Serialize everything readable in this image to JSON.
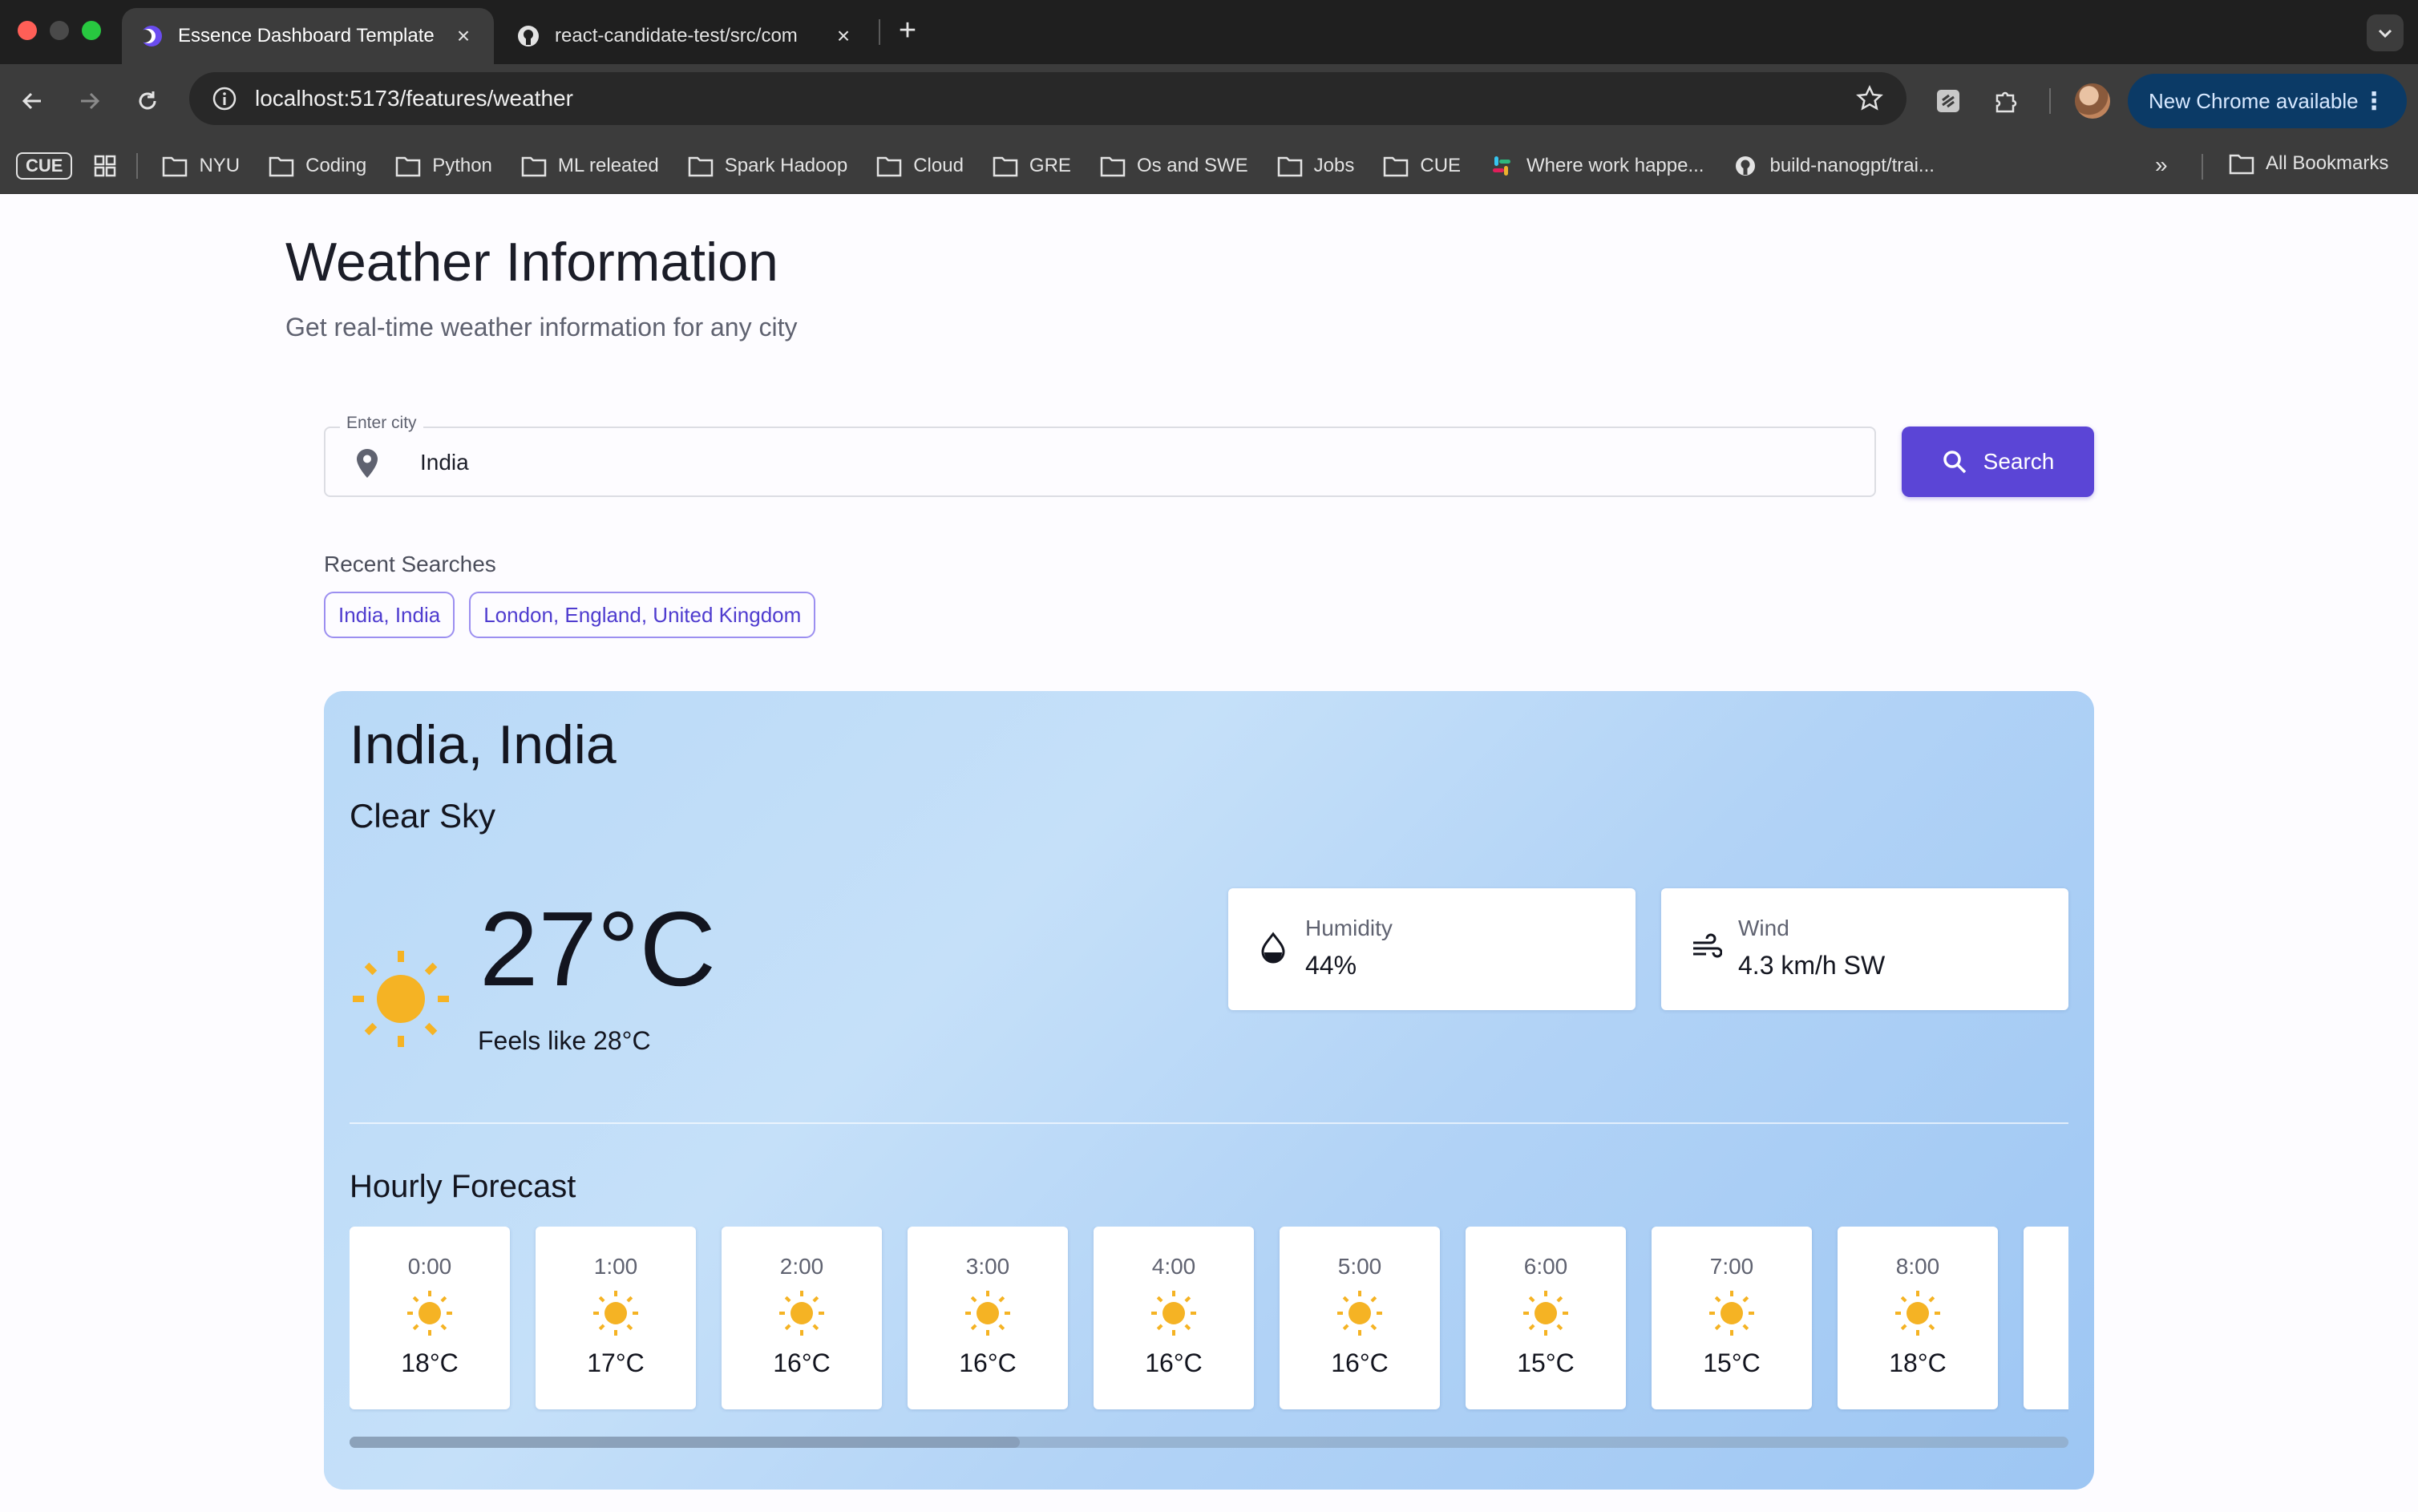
{
  "browser": {
    "tabs": [
      {
        "title": "Essence Dashboard Template",
        "active": true
      },
      {
        "title": "react-candidate-test/src/com",
        "active": false
      }
    ],
    "url": "localhost:5173/features/weather",
    "update_button": "New Chrome available",
    "bookmarks_badge": "CUE",
    "bookmarks": [
      "NYU",
      "Coding",
      "Python",
      "ML releated",
      "Spark Hadoop",
      "Cloud",
      "GRE",
      "Os and SWE",
      "Jobs",
      "CUE",
      "Where work happe...",
      "build-nanogpt/trai..."
    ],
    "all_bookmarks": "All Bookmarks"
  },
  "page": {
    "title": "Weather Information",
    "subtitle": "Get real-time weather information for any city"
  },
  "search": {
    "label": "Enter city",
    "value": "India",
    "button": "Search"
  },
  "recent": {
    "title": "Recent Searches",
    "items": [
      "India, India",
      "London, England, United Kingdom"
    ]
  },
  "weather": {
    "location": "India, India",
    "condition": "Clear Sky",
    "temperature": "27°C",
    "feels_like": "Feels like 28°C",
    "humidity_label": "Humidity",
    "humidity_value": "44%",
    "wind_label": "Wind",
    "wind_value": "4.3 km/h SW",
    "icon": "sun-icon"
  },
  "hourly": {
    "title": "Hourly Forecast",
    "items": [
      {
        "time": "0:00",
        "temp": "18°C"
      },
      {
        "time": "1:00",
        "temp": "17°C"
      },
      {
        "time": "2:00",
        "temp": "16°C"
      },
      {
        "time": "3:00",
        "temp": "16°C"
      },
      {
        "time": "4:00",
        "temp": "16°C"
      },
      {
        "time": "5:00",
        "temp": "16°C"
      },
      {
        "time": "6:00",
        "temp": "15°C"
      },
      {
        "time": "7:00",
        "temp": "15°C"
      },
      {
        "time": "8:00",
        "temp": "18°C"
      }
    ],
    "scroll_fraction": 0.39
  },
  "colors": {
    "accent": "#5b45d6",
    "sun": "#f5b324",
    "chip_text": "#4f3ccf"
  }
}
